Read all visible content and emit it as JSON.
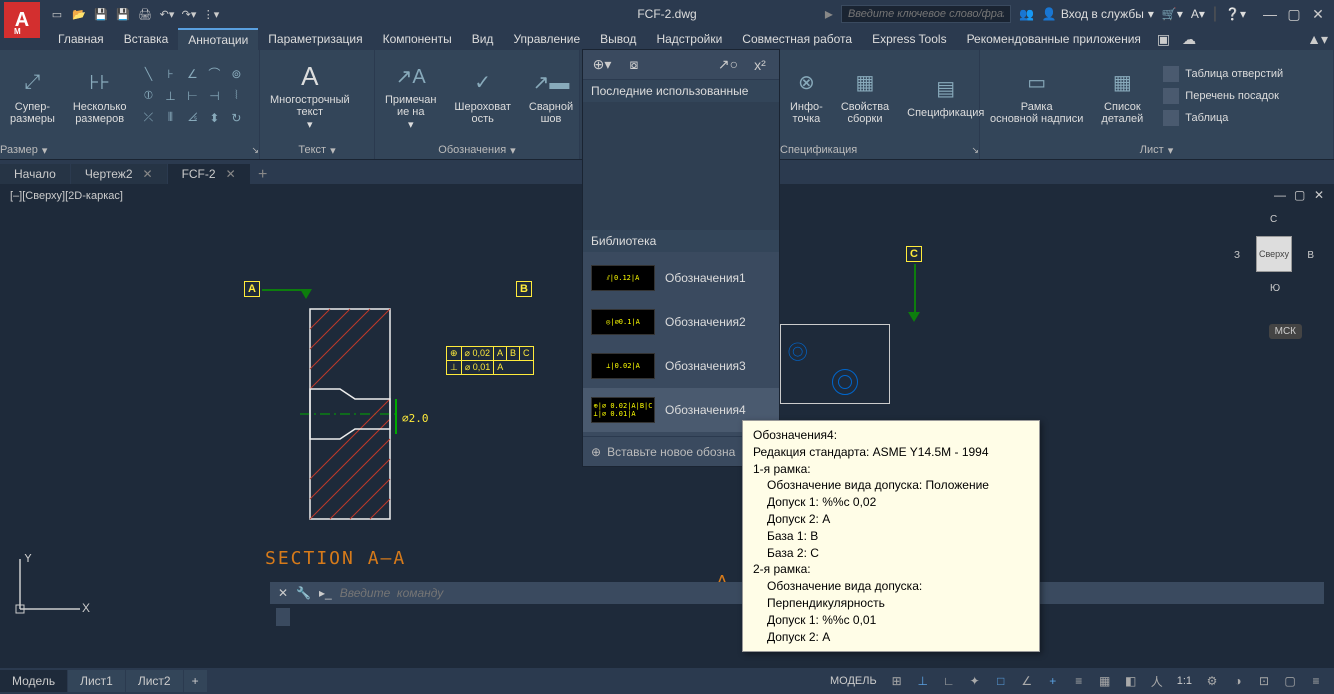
{
  "title": "FCF-2.dwg",
  "search_placeholder": "Введите ключевое слово/фразу",
  "login_label": "Вход в службы",
  "ribbon_tabs": [
    "Главная",
    "Вставка",
    "Аннотации",
    "Параметризация",
    "Компоненты",
    "Вид",
    "Управление",
    "Вывод",
    "Надстройки",
    "Совместная работа",
    "Express Tools",
    "Рекомендованные приложения"
  ],
  "active_ribbon_tab": 2,
  "panels": {
    "dimension": {
      "title": "Размер",
      "super": "Супер-\nразмеры",
      "multi": "Несколько\nразмеров"
    },
    "text": {
      "title": "Текст",
      "mtext": "Многострочный\nтекст"
    },
    "annotations": {
      "title": "Обозначения",
      "note": "Примечан\nие на",
      "rough": "Шероховат\nость",
      "weld": "Сварной\nшов"
    },
    "spec": {
      "title": "Спецификация",
      "info": "Инфо-\nточка",
      "props": "Свойства\nсборки",
      "bom": "Спецификация"
    },
    "sheet": {
      "title": "Лист",
      "frame": "Рамка\nосновной надписи",
      "parts": "Список\nдеталей",
      "list": [
        "Таблица отверстий",
        "Перечень посадок",
        "Таблица"
      ]
    }
  },
  "gallery": {
    "recent_title": "Последние использованные",
    "library_title": "Библиотека",
    "items": [
      "Обозначения1",
      "Обозначения2",
      "Обозначения3",
      "Обозначения4"
    ],
    "footer": "Вставьте новое обозна"
  },
  "file_tabs": [
    "Начало",
    "Чертеж2",
    "FCF-2"
  ],
  "active_file_tab": 2,
  "view_label": "[–][Сверху][2D-каркас]",
  "drawing": {
    "datum_a": "A",
    "datum_b": "B",
    "datum_c": "C",
    "dim_dia": "⌀2.0",
    "fcf1_r1": "⊕ | ⌀ 0,02 | A | B | C",
    "fcf1_r2": "⊥ | ⌀ 0,01 | A",
    "section_title": "SECTION  A—A",
    "detail_label": "A"
  },
  "tooltip": {
    "title": "Обозначения4:",
    "std": "Редакция стандарта: ASME Y14.5M - 1994",
    "f1": "1-я рамка:",
    "f1_type": "Обозначение вида допуска: Положение",
    "f1_t1": "Допуск 1: %%с 0,02",
    "f1_t2": "Допуск 2: A",
    "f1_b1": "База 1: B",
    "f1_b2": "База 2: C",
    "f2": "2-я рамка:",
    "f2_type": "Обозначение вида допуска: Перпендикулярность",
    "f2_t1": "Допуск 1: %%с 0,01",
    "f2_t2": "Допуск 2: A"
  },
  "viewcube": {
    "face": "Сверху",
    "n": "С",
    "s": "Ю",
    "e": "В",
    "w": "З",
    "msk": "МСК"
  },
  "cmd_placeholder": "Введите  команду",
  "status_tabs": [
    "Модель",
    "Лист1",
    "Лист2"
  ],
  "status_model": "МОДЕЛЬ",
  "status_scale": "1:1"
}
